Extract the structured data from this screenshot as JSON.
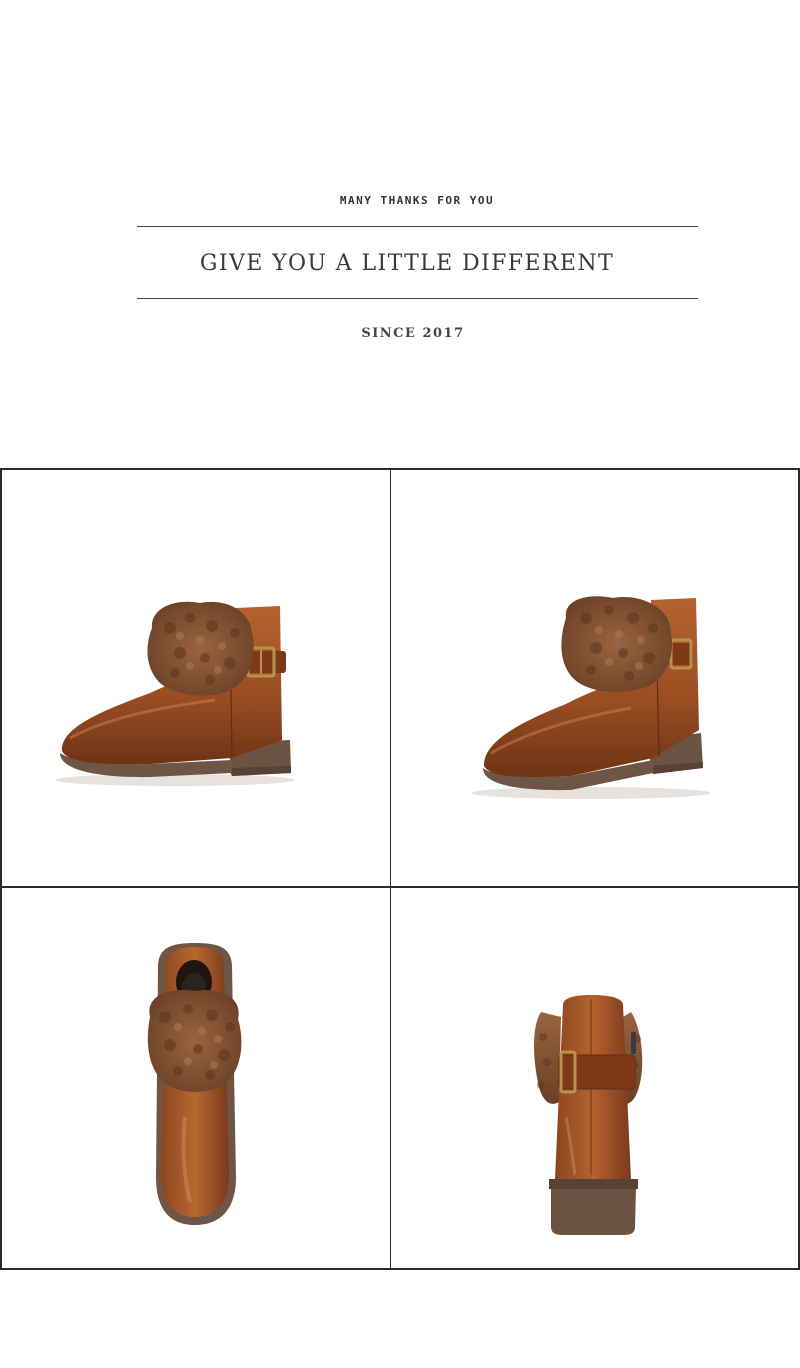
{
  "header": {
    "tagline": "MANY THANKS FOR YOU",
    "headline": "GIVE YOU A LITTLE DIFFERENT",
    "since": "SINCE 2017"
  },
  "gallery": {
    "views": [
      {
        "view": "side-left"
      },
      {
        "view": "side-right"
      },
      {
        "view": "top"
      },
      {
        "view": "back"
      }
    ]
  },
  "colors": {
    "leather": "#A0522D",
    "leather_dark": "#7A3A1C",
    "fur": "#8B5A3C",
    "sole": "#6B5344",
    "buckle": "#B8924A",
    "grid_line": "#2A2A2A"
  }
}
